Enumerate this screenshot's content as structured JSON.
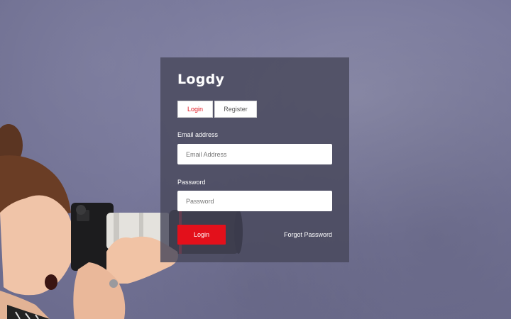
{
  "brand": {
    "name": "Logdy"
  },
  "tabs": [
    {
      "label": "Login",
      "active": true
    },
    {
      "label": "Register",
      "active": false
    }
  ],
  "form": {
    "email_label": "Email address",
    "email_placeholder": "Email Address",
    "password_label": "Password",
    "password_placeholder": "Password",
    "submit_label": "Login",
    "forgot_label": "Forgot Password"
  },
  "colors": {
    "accent": "#e3101b",
    "panel": "#48485c",
    "background": "#77779a"
  },
  "icons": [
    "camera-icon"
  ]
}
